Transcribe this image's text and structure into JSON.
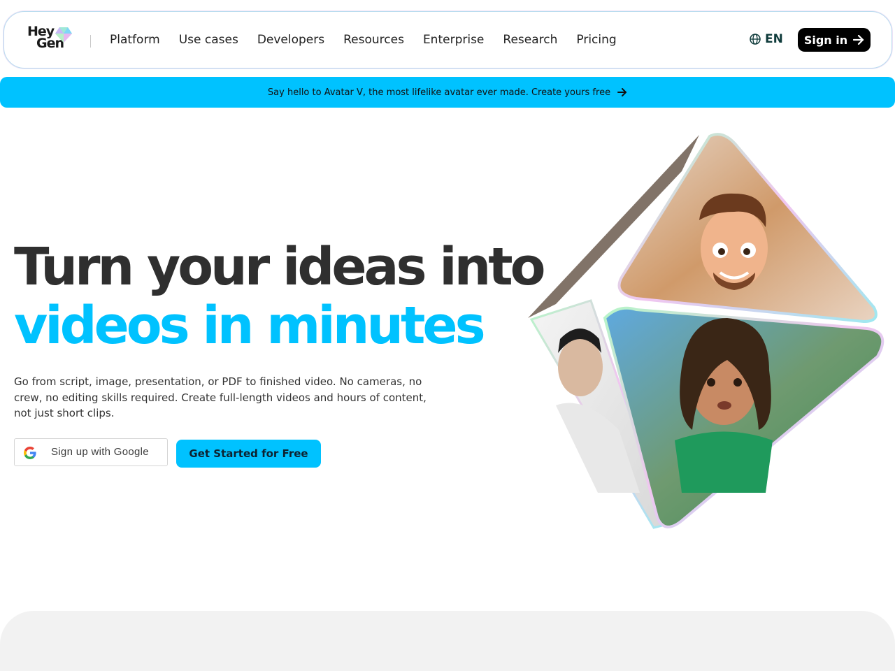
{
  "brand": {
    "logo_line1": "Hey",
    "logo_line2": "Gen"
  },
  "nav": {
    "items": [
      {
        "label": "Platform"
      },
      {
        "label": "Use cases"
      },
      {
        "label": "Developers"
      },
      {
        "label": "Resources"
      },
      {
        "label": "Enterprise"
      },
      {
        "label": "Research"
      },
      {
        "label": "Pricing"
      }
    ],
    "language": "EN",
    "signin_label": "Sign in"
  },
  "banner": {
    "text": "Say hello to Avatar V, the most lifelike avatar ever made. Create yours free"
  },
  "hero": {
    "headline_line1": "Turn your ideas into",
    "headline_line2": "videos in minutes",
    "subtext": "Go from script, image, presentation, or PDF to finished video. No cameras, no crew, no editing skills required. Create full-length videos and hours of content, not just short clips.",
    "google_button": "Sign up with Google",
    "cta_button": "Get Started for Free"
  },
  "colors": {
    "accent": "#00c2ff",
    "headline_dark": "#2f2f2f",
    "signin_bg": "#000000"
  },
  "icons": {
    "globe": "globe-icon",
    "arrow": "arrow-right-icon",
    "google": "google-g-icon"
  }
}
